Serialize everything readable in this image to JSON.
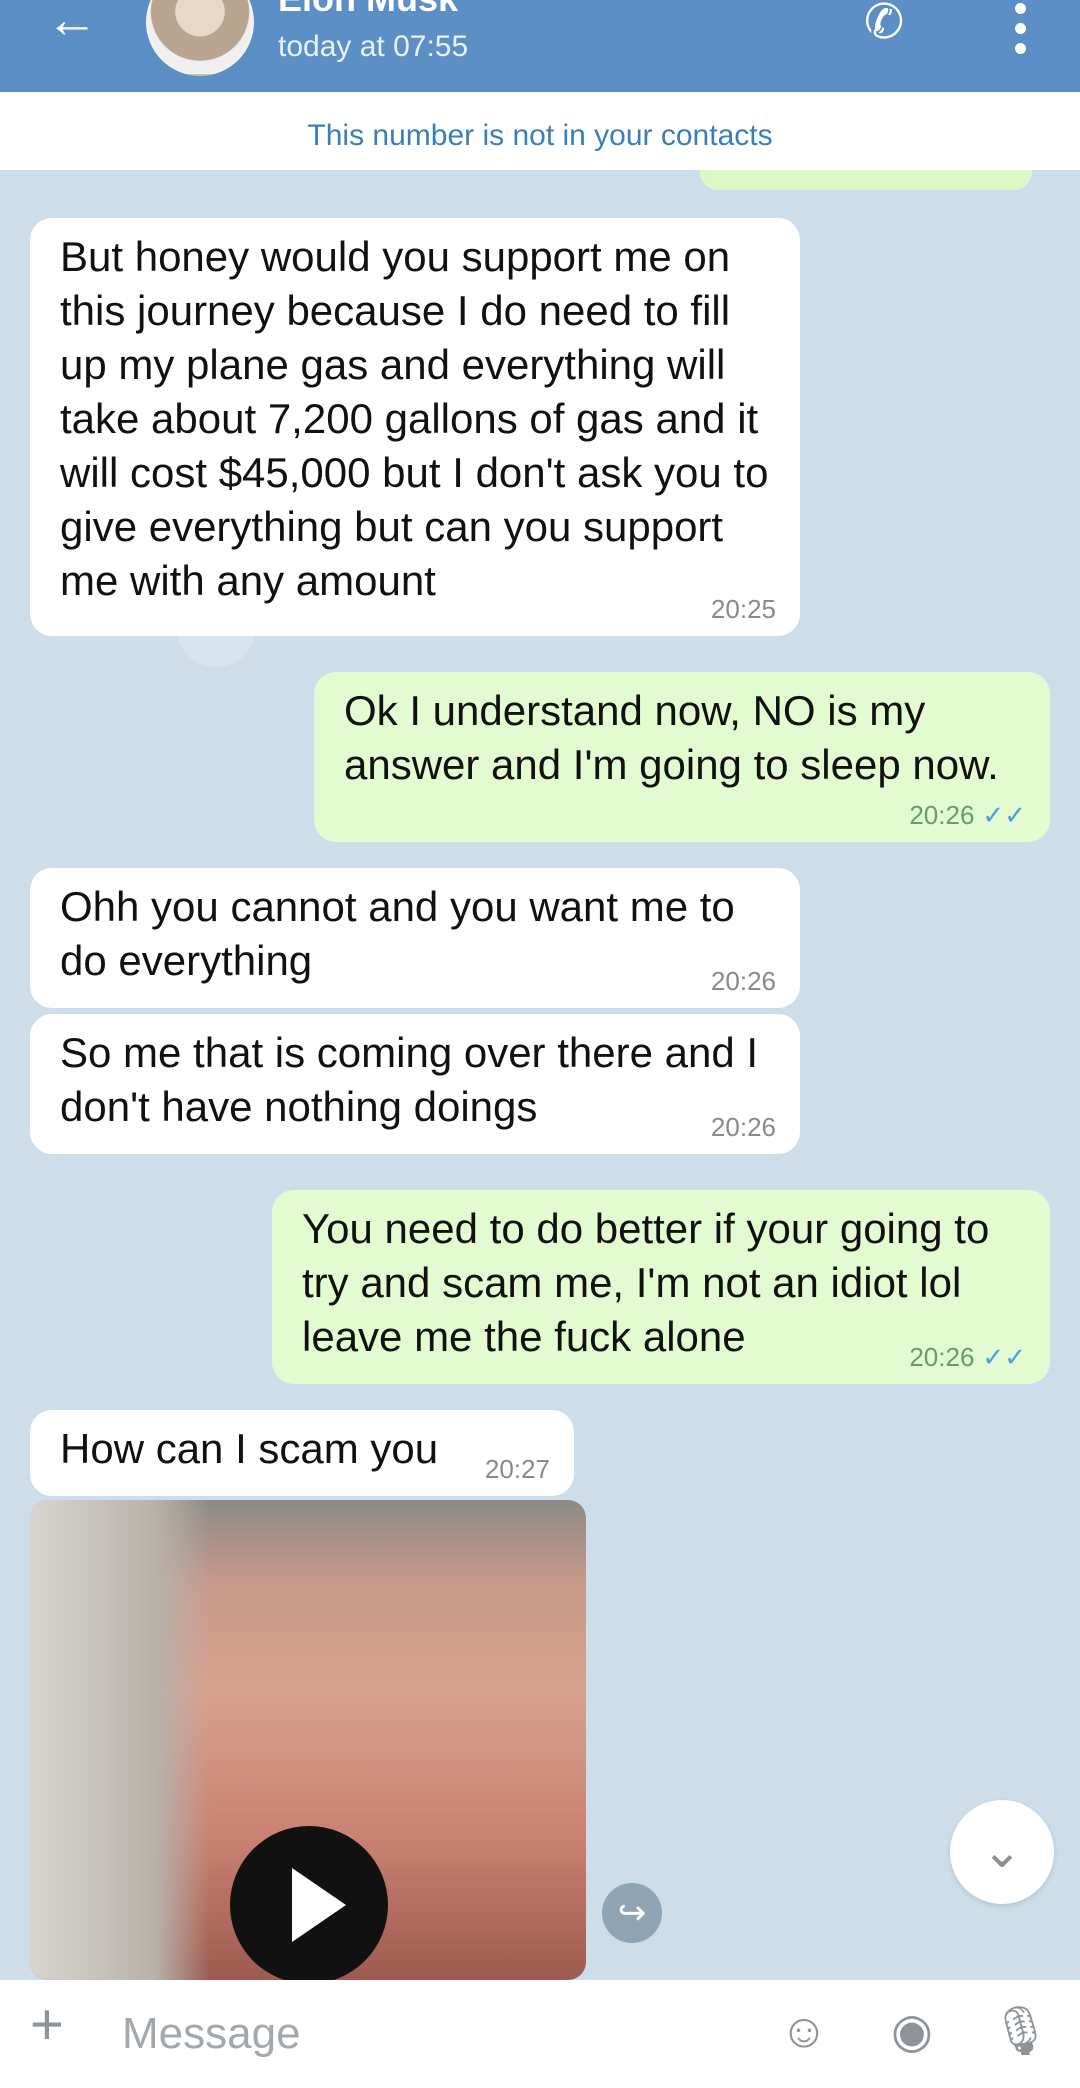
{
  "header": {
    "title": "Elon Musk",
    "subtitle": "today at 07:55",
    "back_icon": "arrow-left-icon",
    "call_icon": "phone-icon",
    "menu_icon": "more-vertical-icon"
  },
  "notice": "This number is not in your contacts",
  "messages": [
    {
      "direction": "incoming",
      "text": "But honey would you support me on this journey because I do need to fill up my plane gas and everything will take about 7,200 gallons of gas and it will cost $45,000 but I don't ask you to give everything but can you support me with any amount",
      "time": "20:25"
    },
    {
      "direction": "outgoing",
      "text": "Ok I understand now, NO is my answer and I'm going to sleep now.",
      "time": "20:26"
    },
    {
      "direction": "incoming",
      "text": "Ohh you cannot and you want me to do  everything",
      "time": "20:26"
    },
    {
      "direction": "incoming",
      "text": "So me that is coming over there and I don't have nothing doings",
      "time": "20:26"
    },
    {
      "direction": "outgoing",
      "text": "You need to do better if your going to try and scam me, I'm not an idiot lol leave me the fuck alone",
      "time": "20:26"
    },
    {
      "direction": "incoming",
      "text": "How can I scam you",
      "time": "20:27"
    }
  ],
  "video": {
    "play_icon": "play-icon"
  },
  "composer": {
    "placeholder": "Message",
    "attach_icon": "plus-icon",
    "emoji_icon": "emoji-icon",
    "camera_icon": "camera-icon",
    "mic_icon": "microphone-icon"
  },
  "colors": {
    "header": "#5b8fc6",
    "incoming_bubble": "#ffffff",
    "outgoing_bubble": "#e2fbd0",
    "read_ticks": "#4d9de0"
  }
}
